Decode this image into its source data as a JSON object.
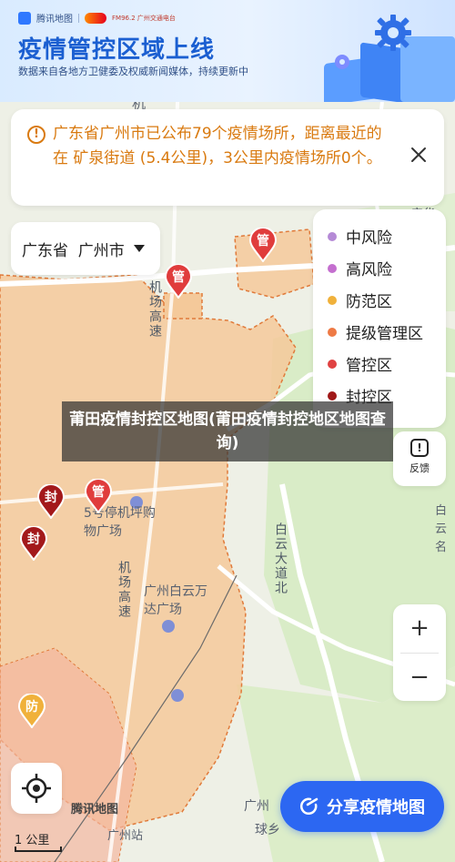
{
  "header": {
    "brand_name": "腾讯地图",
    "radio_name": "FM96.2 广州交通电台",
    "title": "疫情管控区域上线",
    "subtitle": "数据来自各地方卫健委及权威新闻媒体，持续更新中"
  },
  "notice": {
    "text": "广东省广州市已公布79个疫情场所，距离最近的在 矿泉街道 (5.4公里)，3公里内疫情场所0个。"
  },
  "region_select": {
    "value": "广东省  广州市"
  },
  "legend": {
    "items": [
      {
        "label": "中风险",
        "color": "#b58ad6"
      },
      {
        "label": "高风险",
        "color": "#c46fcf"
      },
      {
        "label": "防范区",
        "color": "#f0b13b"
      },
      {
        "label": "提级管理区",
        "color": "#ee7a45"
      },
      {
        "label": "管控区",
        "color": "#e04242"
      },
      {
        "label": "封控区",
        "color": "#a01818"
      }
    ]
  },
  "overlay": {
    "text": "莆田疫情封控区地图(莆田疫情封控地区地图查询)"
  },
  "map": {
    "labels": {
      "airport_expressway_1": "机场高速",
      "airport_expressway_2": "机场高速",
      "baiyun_avenue_north": "白云大道北",
      "parking_mall": "5号停机坪购物广场",
      "wanda_plaza": "广州白云万达广场",
      "baiyun_right": "白云名",
      "anhua": "安华",
      "guangzhou_station": "广州站",
      "guangzhou_bottom": "广州",
      "stadium": "球乡",
      "airport_top": "机"
    },
    "marker_labels": {
      "control": "管",
      "sealed": "封",
      "prevention": "防"
    }
  },
  "controls": {
    "feedback_label": "反馈",
    "zoom_in": "+",
    "zoom_out": "−",
    "share_label": "分享疫情地图",
    "map_logo": "腾讯地图",
    "scale_label": "1 公里"
  }
}
